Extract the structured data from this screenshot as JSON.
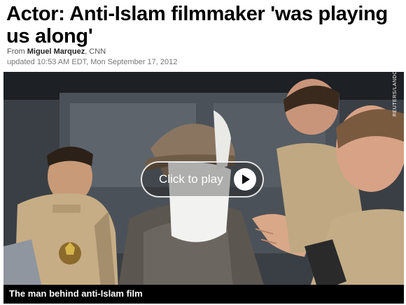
{
  "article": {
    "headline": "Actor: Anti-Islam filmmaker 'was playing us along'",
    "byline_prefix": "From",
    "author": "Miguel Marquez",
    "source": ", CNN",
    "updated": "updated 10:53 AM EDT, Mon September 17, 2012"
  },
  "video": {
    "photo_credit": "REUTERS/LANDOV",
    "play_label": "Click to play",
    "caption": "The man behind anti-Islam film",
    "icons": {
      "play": "play-icon"
    }
  }
}
